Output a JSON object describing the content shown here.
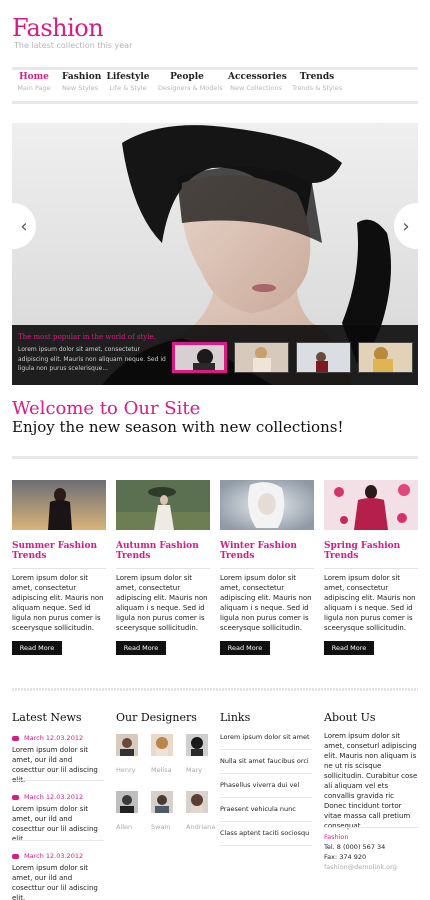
{
  "site": {
    "logo": "Fashion",
    "tagline": "The latest collection this year"
  },
  "nav": [
    {
      "label": "Home",
      "sub": "Main Page",
      "active": true
    },
    {
      "label": "Fashion",
      "sub": "New Styles"
    },
    {
      "label": "Lifestyle",
      "sub": "Life & Style"
    },
    {
      "label": "People",
      "sub": "Designers & Models"
    },
    {
      "label": "Accessories",
      "sub": "New Collections"
    },
    {
      "label": "Trends",
      "sub": "Trends & Styles"
    }
  ],
  "slider": {
    "prev_icon": "‹",
    "next_icon": "›",
    "caption_title": "The most popular in the world of style.",
    "caption_text": "Lorem ipsum dolor sit amet, consectetur adipiscing elit. Mauris non aliquam neque. Sed id ligula non purus scelerisque...",
    "thumbs": [
      "thumb-1",
      "thumb-2",
      "thumb-3",
      "thumb-4"
    ],
    "selected_thumb": 1
  },
  "welcome": {
    "title": "Welcome to Our Site",
    "subtitle": "Enjoy the new season with new collections!"
  },
  "features": [
    {
      "title": "Summer Fashion Trends",
      "text": "Lorem ipsum dolor sit amet, consectetur adipiscing elit. Mauris non aliquam neque. Sed id ligula non purus comer is sceerysque sollicitudin.",
      "button": "Read More"
    },
    {
      "title": "Autumn Fashion Trends",
      "text": "Lorem ipsum dolor sit amet, consectetur adipiscing elit. Mauris non aliquam i s neque. Sed id ligula non purus comer is sceerysque sollicitudin.",
      "button": "Read More"
    },
    {
      "title": "Winter Fashion Trends",
      "text": "Lorem ipsum dolor sit amet, consectetur adipiscing elit. Mauris non aliquam i s neque. Sed id ligula non purus comer is sceerysque sollicitudin.",
      "button": "Read More"
    },
    {
      "title": "Spring Fashion Trends",
      "text": "Lorem ipsum dolor sit amet, consectetur adipiscing elit. Mauris non aliquam i s neque. Sed id ligula non purus comer is sceerysque sollicitudin.",
      "button": "Read More"
    }
  ],
  "latest_news": {
    "title": "Latest News",
    "items": [
      {
        "date": "March 12.03.2012",
        "text": "Lorem ipsum dolor sit amet, our ild and cosecttur our lil adiscing elit."
      },
      {
        "date": "March 12.03.2012",
        "text": "Lorem ipsum dolor sit amet, our ild and cosecttur our lil adiscing elit."
      },
      {
        "date": "March 12.03.2012",
        "text": "Lorem ipsum dolor sit amet, our ild and cosecttur our lil adiscing elit."
      }
    ]
  },
  "designers": {
    "title": "Our Designers",
    "people": [
      "Henry",
      "Melisa",
      "Mary",
      "Allen",
      "Swain",
      "Andriana"
    ]
  },
  "links": {
    "title": "Links",
    "items": [
      "Lorem ipsum dolor sit amet",
      "Nulla sit amet faucibus orci",
      "Phasellus viverra dui vel",
      "Praesent vehicula nunc",
      "Class aptent taciti sociosqu"
    ]
  },
  "about": {
    "title": "About Us",
    "text": "Lorem ipsum dolor sit amet, conseturl adipiscing elit. Mauris non aliquam is ne ut ris scisque sollicitudin. Curabitur cose ali aliquam vel ets convallis gravida ric Donec tincidunt tortor vitae massa call pretium consequat.",
    "company": "Fashion",
    "tel": "Tel. 8 (000) 567 34",
    "fax": "Fax: 374 920",
    "email": "fashion@demolink.org"
  },
  "colors": {
    "accent": "#d91b86",
    "dark": "#111111"
  }
}
